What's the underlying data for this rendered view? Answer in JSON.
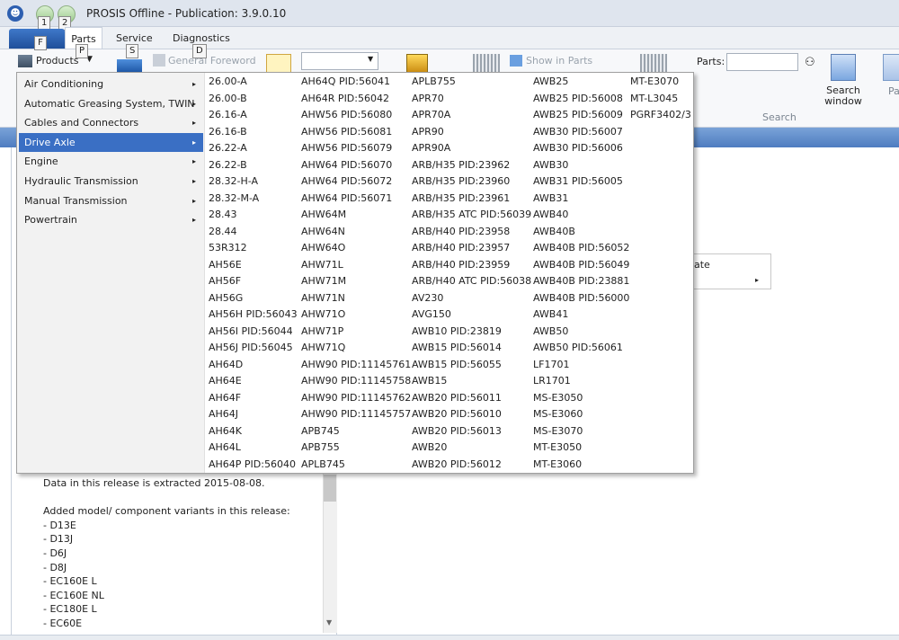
{
  "window": {
    "title": "PROSIS Offline - Publication: 3.9.0.10",
    "app_icon_glyph": "☻"
  },
  "keytips": {
    "k1": "1",
    "k2": "2",
    "f": "F",
    "p": "P",
    "s": "S",
    "d": "D"
  },
  "ribbon": {
    "tabs": {
      "parts": "Parts",
      "service": "Service",
      "diagnostics": "Diagnostics"
    },
    "products_label": "Products",
    "products_arrow": "▼",
    "general_foreword": "General Foreword",
    "show_in_parts": "Show in Parts",
    "parts_search_label": "Parts:",
    "search_window_label": "Search window",
    "search_group_label": "Search",
    "right_edge_label": "Pa",
    "select_arrow": "▼",
    "binoculars_glyph": "⚇"
  },
  "menu": {
    "submenu_arrow": "▸",
    "categories": [
      "Air Conditioning",
      "Automatic Greasing System, TWIN",
      "Cables and Connectors",
      "Drive Axle",
      "Engine",
      "Hydraulic Transmission",
      "Manual Transmission",
      "Powertrain"
    ],
    "selected_category": "Drive Axle",
    "columns": [
      [
        "26.00-A",
        "26.00-B",
        "26.16-A",
        "26.16-B",
        "26.22-A",
        "26.22-B",
        "28.32-H-A",
        "28.32-M-A",
        "28.43",
        "28.44",
        "53R312",
        "AH56E",
        "AH56F",
        "AH56G",
        "AH56H PID:56043",
        "AH56I PID:56044",
        "AH56J PID:56045",
        "AH64D",
        "AH64E",
        "AH64F",
        "AH64J",
        "AH64K",
        "AH64L",
        "AH64P PID:56040"
      ],
      [
        "AH64Q PID:56041",
        "AH64R PID:56042",
        "AHW56 PID:56080",
        "AHW56 PID:56081",
        "AHW56 PID:56079",
        "AHW64 PID:56070",
        "AHW64 PID:56072",
        "AHW64 PID:56071",
        "AHW64M",
        "AHW64N",
        "AHW64O",
        "AHW71L",
        "AHW71M",
        "AHW71N",
        "AHW71O",
        "AHW71P",
        "AHW71Q",
        "AHW90 PID:11145761",
        "AHW90 PID:11145758",
        "AHW90 PID:11145762",
        "AHW90 PID:11145757",
        "APB745",
        "APB755",
        "APLB745"
      ],
      [
        "APLB755",
        "APR70",
        "APR70A",
        "APR90",
        "APR90A",
        "ARB/H35 PID:23962",
        "ARB/H35 PID:23960",
        "ARB/H35 PID:23961",
        "ARB/H35 ATC PID:56039",
        "ARB/H40 PID:23958",
        "ARB/H40 PID:23957",
        "ARB/H40 PID:23959",
        "ARB/H40 ATC PID:56038",
        "AV230",
        "AVG150",
        "AWB10 PID:23819",
        "AWB15 PID:56014",
        "AWB15 PID:56055",
        "AWB15",
        "AWB20 PID:56011",
        "AWB20 PID:56010",
        "AWB20 PID:56013",
        "AWB20",
        "AWB20 PID:56012"
      ],
      [
        "AWB25",
        "AWB25 PID:56008",
        "AWB25 PID:56009",
        "AWB30 PID:56007",
        "AWB30 PID:56006",
        "AWB30",
        "AWB31 PID:56005",
        "AWB31",
        "AWB40",
        "AWB40B",
        "AWB40B PID:56052",
        "AWB40B PID:56049",
        "AWB40B PID:23881",
        "AWB40B PID:56000",
        "AWB41",
        "AWB50",
        "AWB50 PID:56061",
        "LF1701",
        "LR1701",
        "MS-E3050",
        "MS-E3060",
        "MS-E3070",
        "MT-E3050",
        "MT-E3060"
      ],
      [
        "MT-E3070",
        "MT-L3045",
        "PGRF3402/3"
      ]
    ]
  },
  "background": {
    "submenu_partial_label": "ate",
    "release_lines": [
      "Data in this release is extracted 2015-08-08.",
      "",
      "Added model/ component variants in this release:",
      "- D13E",
      "- D13J",
      "- D6J",
      "- D8J",
      "- EC160E L",
      "- EC160E NL",
      "- EC180E L",
      "- EC60E"
    ],
    "scroll_down_glyph": "▼"
  }
}
